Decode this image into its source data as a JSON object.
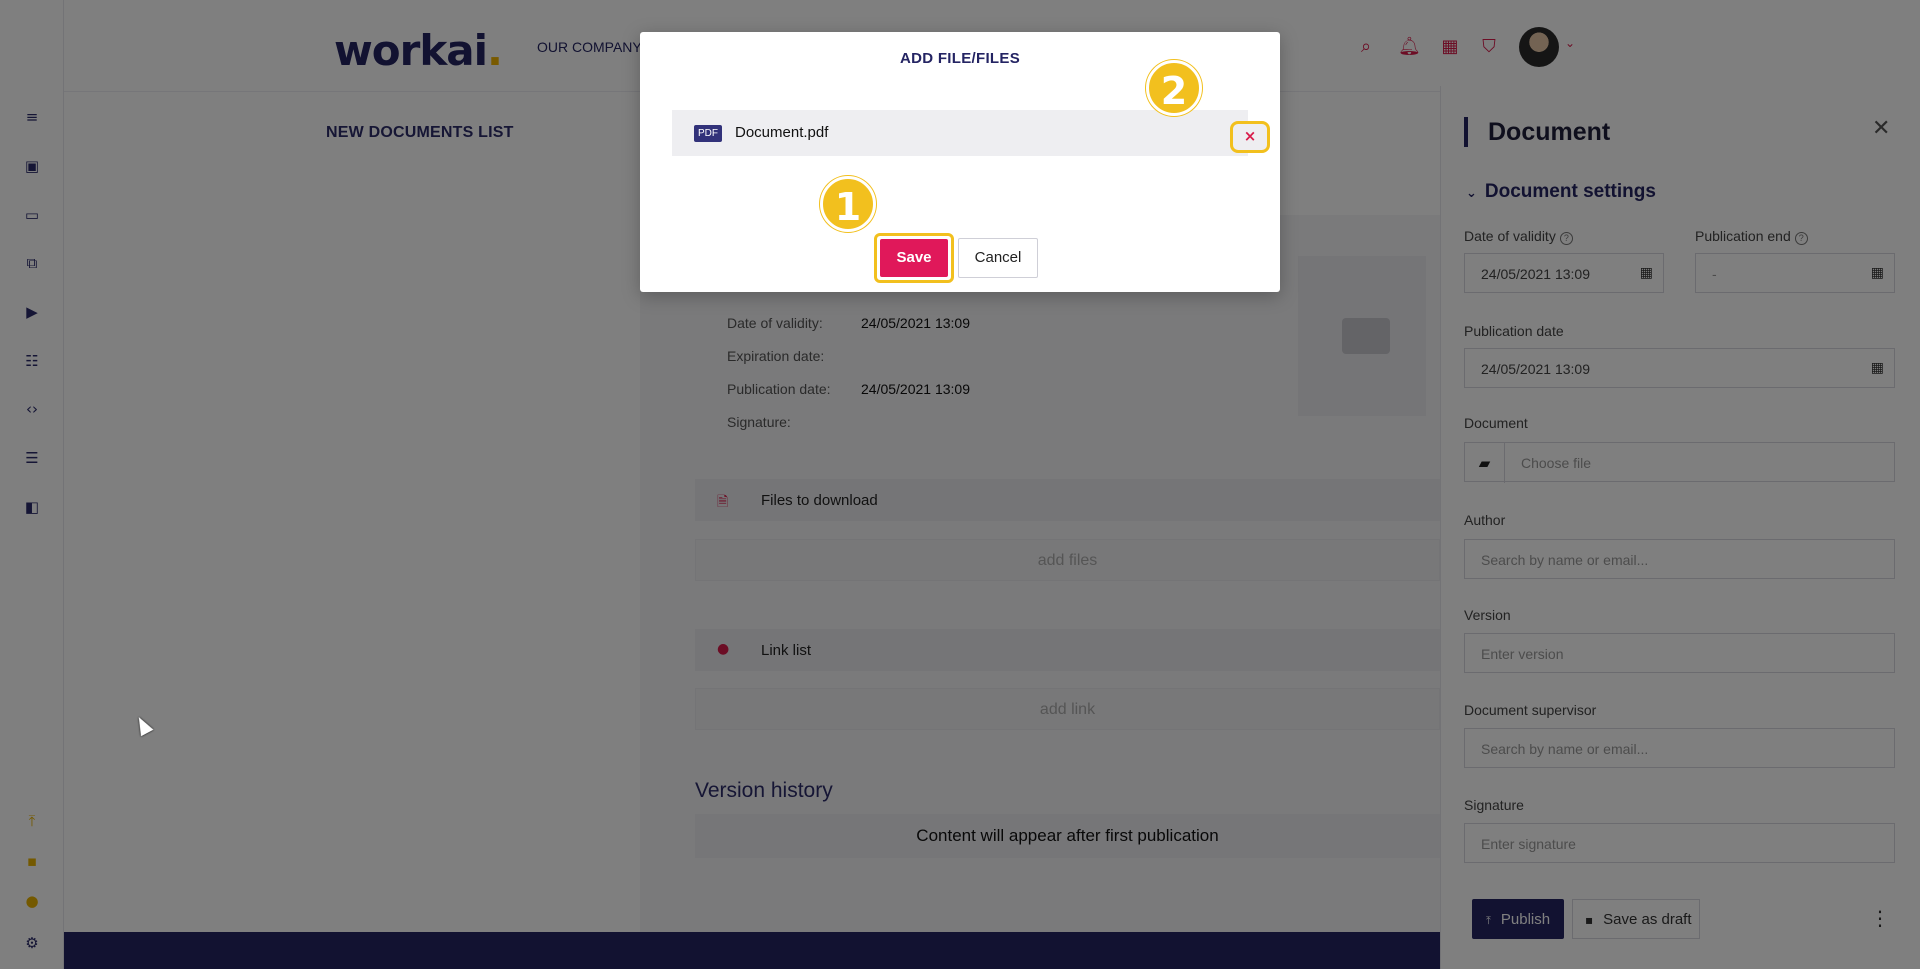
{
  "app": {
    "logo_text": "workai",
    "logo_dot": "."
  },
  "header": {
    "nav_label": "OUR COMPANY",
    "icons": [
      "search-icon",
      "bell-icon",
      "apps-grid-icon",
      "bookmark-icon"
    ],
    "accent_color": "#d81b4a"
  },
  "rail": {
    "icons": [
      "text-lines-icon",
      "image-icon",
      "folder-icon",
      "edit-external-icon",
      "video-icon",
      "table-icon",
      "code-icon",
      "list-icon",
      "office-icon"
    ],
    "bottom_icons": [
      "publish-icon",
      "save-icon",
      "badge-icon",
      "gear-icon"
    ]
  },
  "main": {
    "list_title": "NEW DOCUMENTS LIST",
    "meta": [
      {
        "label": "Date of validity:",
        "value": "24/05/2021 13:09"
      },
      {
        "label": "Expiration date:",
        "value": ""
      },
      {
        "label": "Publication date:",
        "value": "24/05/2021 13:09"
      },
      {
        "label": "Signature:",
        "value": ""
      }
    ],
    "files_section": "Files to download",
    "add_files": "add files",
    "links_section": "Link list",
    "add_link": "add link",
    "version_history_title": "Version history",
    "version_history_empty": "Content will appear after first publication"
  },
  "side_panel": {
    "title": "Document",
    "settings_header": "Document settings",
    "date_of_validity_label": "Date of validity",
    "date_of_validity_value": "24/05/2021 13:09",
    "publication_end_label": "Publication end",
    "publication_end_value": "-",
    "publication_date_label": "Publication date",
    "publication_date_value": "24/05/2021 13:09",
    "document_label": "Document",
    "document_placeholder": "Choose file",
    "author_label": "Author",
    "author_placeholder": "Search by name or email...",
    "version_label": "Version",
    "version_placeholder": "Enter version",
    "supervisor_label": "Document supervisor",
    "supervisor_placeholder": "Search by name or email...",
    "signature_label": "Signature",
    "signature_placeholder": "Enter signature",
    "publish_label": "Publish",
    "draft_label": "Save as draft",
    "brand_color": "#242463"
  },
  "modal": {
    "title": "ADD FILE/FILES",
    "file_type": "PDF",
    "file_name": "Document.pdf",
    "remove_symbol": "×",
    "save_label": "Save",
    "cancel_label": "Cancel",
    "save_color": "#e0185a",
    "highlight_color": "#f2c01e"
  },
  "annotations": {
    "step1": "1",
    "step2": "2"
  }
}
